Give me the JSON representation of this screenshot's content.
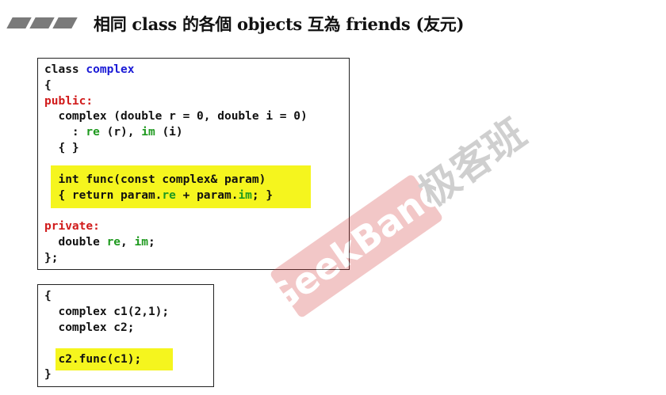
{
  "header": {
    "title": "相同 class 的各個 objects 互為 friends (友元)"
  },
  "code_box_1": {
    "lines": [
      {
        "a": "class ",
        "b": "complex"
      },
      {
        "a": "{"
      },
      {
        "a": "public:"
      },
      {
        "a": "  complex (double r = 0, double i = 0)"
      },
      {
        "a": "    : ",
        "b": "re",
        "c": " (r), ",
        "d": "im",
        "e": " (i)"
      },
      {
        "a": "  { }"
      },
      {
        "a": "  int func(const complex& param)"
      },
      {
        "a": "  { return param.",
        "b": "re",
        "c": " + param.",
        "d": "im",
        "e": "; }"
      },
      {
        "a": "private:"
      },
      {
        "a": "  double ",
        "b": "re",
        "c": ", ",
        "d": "im",
        "e": ";"
      },
      {
        "a": "};"
      }
    ]
  },
  "code_box_2": {
    "lines": [
      {
        "a": "{"
      },
      {
        "a": "  complex c1(2,1);"
      },
      {
        "a": "  complex c2;"
      },
      {
        "a": "  c2.func(c1);"
      },
      {
        "a": "}"
      }
    ]
  },
  "watermark": {
    "brand": "GeekBand",
    "cn": "极客班"
  },
  "colors": {
    "type_keyword": "#1a1ad6",
    "access_keyword": "#d11b1b",
    "member": "#1f9a1f",
    "highlight": "#f5f51e",
    "watermark": "#d43a3a"
  }
}
